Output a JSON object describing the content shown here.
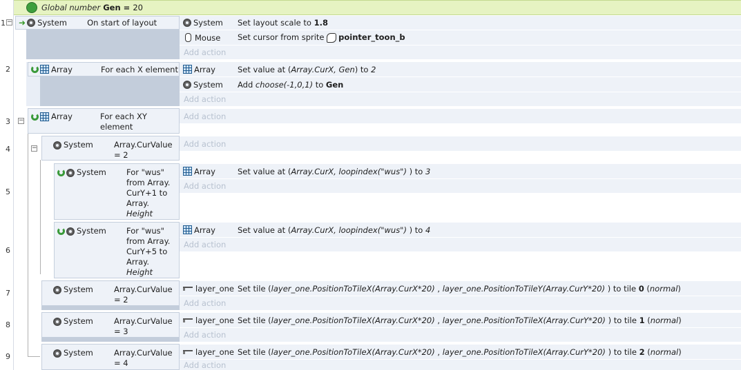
{
  "global_var": {
    "kind": "Global number",
    "name": "Gen",
    "op": "=",
    "value": "20"
  },
  "add_action": "Add action",
  "events": [
    {
      "num": "1",
      "obj": "System",
      "cond": "On start of layout",
      "actions": [
        {
          "obj": "System",
          "pre": "Set layout scale to ",
          "bold": "1.8"
        },
        {
          "obj": "Mouse",
          "pre": "Set cursor from sprite ",
          "bold": "pointer_toon_b"
        }
      ]
    },
    {
      "num": "2",
      "obj": "Array",
      "cond": "For each X element",
      "actions": [
        {
          "obj": "Array",
          "t1": "Set value at (",
          "i1": "Array.CurX, Gen",
          "t2": ") to ",
          "i2": "2"
        },
        {
          "obj": "System",
          "t1": "Add ",
          "i1": "choose(-1,0,1)",
          "t2": "  to ",
          "b": "Gen"
        }
      ]
    },
    {
      "num": "3",
      "obj": "Array",
      "cond1": "For each XY",
      "cond2": "element"
    },
    {
      "num": "4",
      "obj": "System",
      "cond1": "Array.CurValue",
      "cond2": "= 2"
    },
    {
      "num": "5",
      "obj": "System",
      "cond": [
        "For \"wus\"",
        "from Array.",
        "CurY+1 to",
        "Array.",
        "Height"
      ],
      "action": {
        "obj": "Array",
        "t1": "Set value at (",
        "i1": "Array.CurX, loopindex(\"wus\")",
        "t2": " ) to ",
        "i2": "3"
      }
    },
    {
      "num": "6",
      "obj": "System",
      "cond": [
        "For \"wus\"",
        "from Array.",
        "CurY+5 to",
        "Array.",
        "Height"
      ],
      "action": {
        "obj": "Array",
        "t1": "Set value at (",
        "i1": "Array.CurX, loopindex(\"wus\")",
        "t2": " ) to ",
        "i2": "4"
      }
    },
    {
      "num": "7",
      "obj": "System",
      "cond1": "Array.CurValue",
      "cond2": "= 2",
      "action": {
        "obj": "layer_one",
        "t1": "Set tile (",
        "i1": "layer_one.PositionToTileX(Array.CurX*20)",
        "t2": "  , ",
        "i2": "layer_one.PositionToTileY(Array.CurY*20)",
        "t3": "  ) to tile ",
        "b": "0",
        "t4": " (",
        "i3": "normal",
        "t5": ")"
      }
    },
    {
      "num": "8",
      "obj": "System",
      "cond1": "Array.CurValue",
      "cond2": "= 3",
      "action": {
        "obj": "layer_one",
        "t1": "Set tile (",
        "i1": "layer_one.PositionToTileX(Array.CurX*20)",
        "t2": "  , ",
        "i2": "layer_one.PositionToTileX(Array.CurY*20)",
        "t3": "  ) to tile ",
        "b": "1",
        "t4": " (",
        "i3": "normal",
        "t5": ")"
      }
    },
    {
      "num": "9",
      "obj": "System",
      "cond1": "Array.CurValue",
      "cond2": "= 4",
      "action": {
        "obj": "layer_one",
        "t1": "Set tile (",
        "i1": "layer_one.PositionToTileX(Array.CurX*20)",
        "t2": "  , ",
        "i2": "layer_one.PositionToTileX(Array.CurY*20)",
        "t3": "  ) to tile ",
        "b": "2",
        "t4": " (",
        "i3": "normal",
        "t5": ")"
      }
    }
  ]
}
